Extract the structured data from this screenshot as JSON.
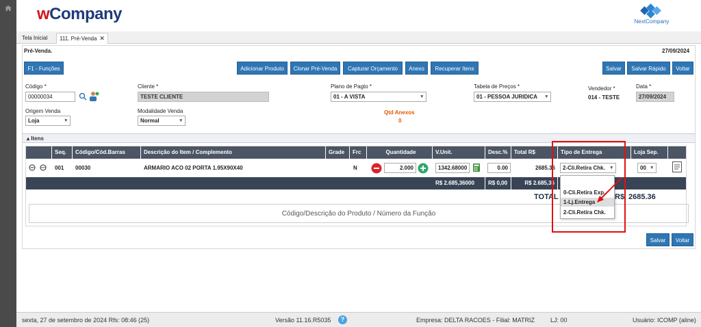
{
  "header": {
    "brand_w": "w",
    "brand_rest": "Company",
    "partner_logo_text": "NextCompany"
  },
  "tabs": [
    {
      "label": "Tela Inicial"
    },
    {
      "label": "111. Pré-Venda",
      "close": "✕"
    }
  ],
  "page": {
    "title": "Pré-Venda.",
    "date": "27/09/2024"
  },
  "toolbar": {
    "funcoes": "F1 - Funções",
    "adicionar": "Adicionar Produto",
    "clonar": "Clonar Pré-Venda",
    "capturar": "Capturar Orçamento",
    "anexo": "Anexo",
    "recuperar": "Recuperar Itens",
    "salvar": "Salvar",
    "salvar_rapido": "Salvar Rápido",
    "voltar": "Voltar"
  },
  "form": {
    "codigo_label": "Código *",
    "codigo_value": "00000034",
    "cliente_label": "Cliente *",
    "cliente_value": "TESTE CLIENTE",
    "plano_label": "Plano de Pagto *",
    "plano_value": "01 - A VISTA",
    "tabela_label": "Tabela de Preços *",
    "tabela_value": "01 - PESSOA JURIDICA",
    "vendedor_label": "Vendedor *",
    "vendedor_value": "014 - TESTE",
    "data_label": "Data *",
    "data_value": "27/09/2024",
    "origem_label": "Origem Venda",
    "origem_value": "Loja",
    "modalidade_label": "Modalidade Venda",
    "modalidade_value": "Normal",
    "qtd_anexos_label": "Qtd Anexos",
    "qtd_anexos_value": "0"
  },
  "items": {
    "section_label": "Itens",
    "columns": [
      "Seq.",
      "Código/Cód.Barras",
      "Descrição do Item / Complemento",
      "Grade",
      "Frc",
      "Quantidade",
      "V.Unit.",
      "Desc.%",
      "Total R$",
      "Tipo de Entrega",
      "Loja Sep."
    ],
    "row": {
      "seq": "001",
      "codigo": "00030",
      "descricao": "ARMARIO ACO 02 PORTA 1.95X90X40",
      "grade": "",
      "frc": "N",
      "quantidade": "2.000",
      "vunit": "1342.68000",
      "desc": "0.00",
      "total": "2685.36",
      "tipo_entrega": "2-Cli.Retira Chk.",
      "loja_sep": "00"
    },
    "totals": {
      "vunit": "R$ 2.685,36000",
      "desc": "R$ 0,00",
      "total": "R$ 2.685,36"
    },
    "total_label": "TOTAL",
    "total_currency": "R$",
    "total_value": "2685.36",
    "search_placeholder": "Código/Descrição do Produto / Número da Função"
  },
  "dropdown": {
    "options": [
      "0-Cli.Retira Exp.",
      "1-Lj.Entrega",
      "2-Cli.Retira Chk."
    ],
    "highlighted": "1-Lj.Entrega"
  },
  "footer_buttons": {
    "salvar": "Salvar",
    "voltar": "Voltar"
  },
  "status": {
    "datetime": "sexta, 27 de setembro de 2024  Rfs: 08:46 (25)",
    "versao": "Versão 11.16.R5035",
    "help": "?",
    "empresa": "Empresa: DELTA RACOES - Filial: MATRIZ",
    "lj": "LJ: 00",
    "usuario": "Usuário: ICOMP (aline)"
  },
  "colors": {
    "primary_button": "#2f76b5",
    "table_header": "#4b5564",
    "highlight_box": "#e01010",
    "anexos": "#e05a00"
  }
}
